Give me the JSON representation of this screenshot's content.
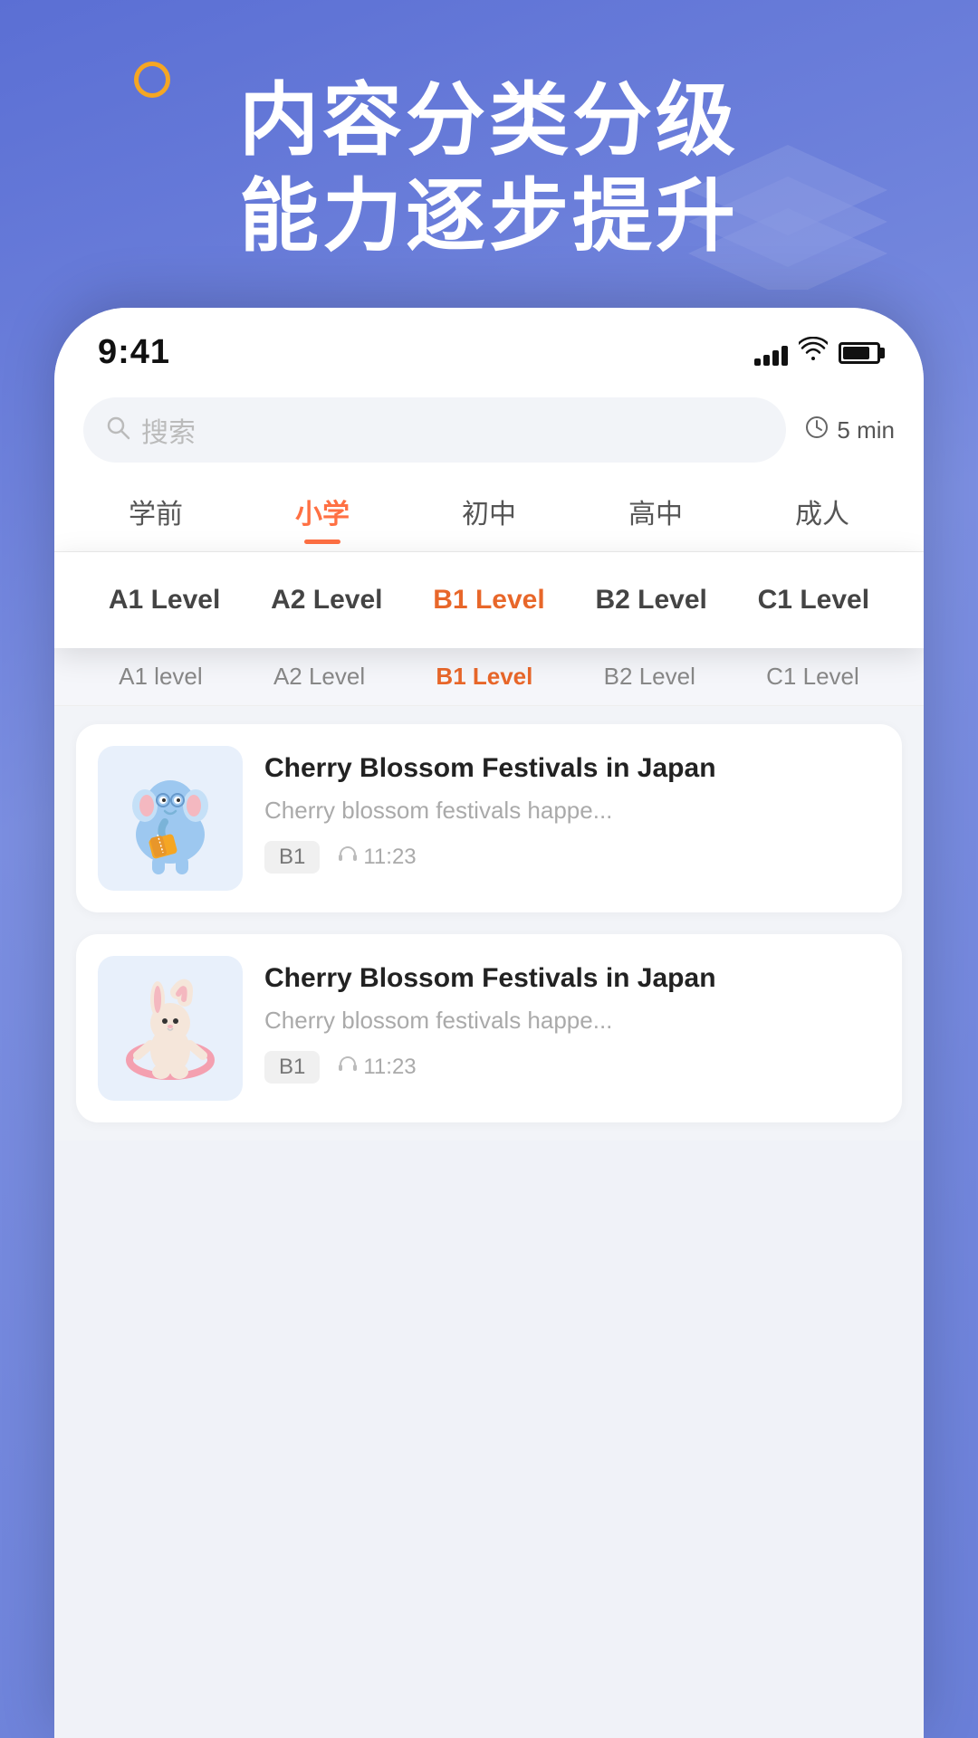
{
  "hero": {
    "title_line1": "内容分类分级",
    "title_line2": "能力逐步提升"
  },
  "status_bar": {
    "time": "9:41",
    "signal_bars": [
      8,
      12,
      16,
      20,
      24
    ],
    "battery_percent": 80
  },
  "search": {
    "placeholder": "搜索",
    "time_filter": "5 min"
  },
  "category_tabs": [
    {
      "label": "学前",
      "active": false
    },
    {
      "label": "小学",
      "active": true
    },
    {
      "label": "初中",
      "active": false
    },
    {
      "label": "高中",
      "active": false
    },
    {
      "label": "成人",
      "active": false
    }
  ],
  "level_tabs_overlay": [
    {
      "label": "A1 Level",
      "active": false
    },
    {
      "label": "A2 Level",
      "active": false
    },
    {
      "label": "B1 Level",
      "active": true
    },
    {
      "label": "B2 Level",
      "active": false
    },
    {
      "label": "C1 Level",
      "active": false
    }
  ],
  "sub_level_tabs": [
    {
      "label": "A1 level",
      "active": false
    },
    {
      "label": "A2 Level",
      "active": false
    },
    {
      "label": "B1 Level",
      "active": true
    },
    {
      "label": "B2 Level",
      "active": false
    },
    {
      "label": "C1 Level",
      "active": false
    }
  ],
  "articles": [
    {
      "id": "article-1",
      "title": "Cherry Blossom Festivals in Japan",
      "description": "Cherry blossom festivals happe...",
      "level": "B1",
      "duration": "11:23",
      "thumb_type": "elephant"
    },
    {
      "id": "article-2",
      "title": "Cherry Blossom Festivals in Japan",
      "description": "Cherry blossom festivals happe...",
      "level": "B1",
      "duration": "11:23",
      "thumb_type": "bunny"
    }
  ]
}
